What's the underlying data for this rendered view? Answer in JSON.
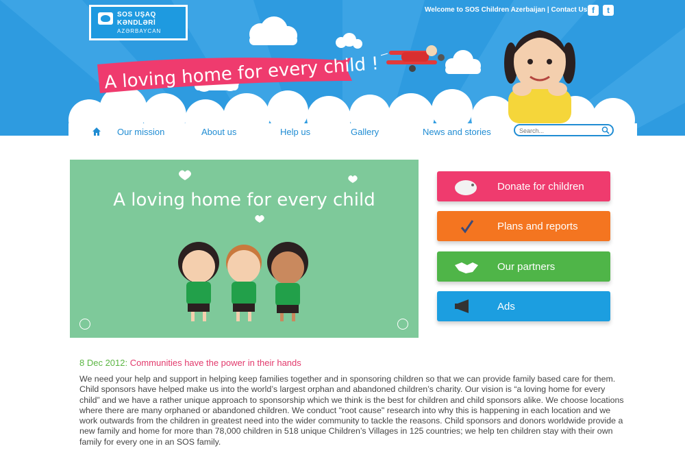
{
  "header": {
    "logo": {
      "line1": "SOS UŞAQ",
      "line2": "KƏNDLƏRİ",
      "line3": "AZƏRBAYCAN"
    },
    "welcome": "Welcome to SOS Children Azerbaijan",
    "separator": " | ",
    "contact": "Contact Us",
    "banner_text": "A loving home for every child !",
    "social": {
      "facebook": "f",
      "twitter": "t"
    }
  },
  "nav": {
    "items": [
      {
        "label": "Our mission"
      },
      {
        "label": "About us"
      },
      {
        "label": "Help us"
      },
      {
        "label": "Gallery"
      },
      {
        "label": "News and stories"
      }
    ]
  },
  "search": {
    "placeholder": "Search..."
  },
  "slider": {
    "text": "A loving home for every child"
  },
  "actions": [
    {
      "label": "Donate for children",
      "icon": "piggy-bank-icon",
      "color": "#ef3b6e"
    },
    {
      "label": "Plans and reports",
      "icon": "checkmark-icon",
      "color": "#f47520"
    },
    {
      "label": "Our partners",
      "icon": "handshake-icon",
      "color": "#4fb548"
    },
    {
      "label": "Ads",
      "icon": "megaphone-icon",
      "color": "#1c9ee0"
    }
  ],
  "news": {
    "date": "8 Dec 2012:",
    "title": "Communities have the power in their hands",
    "body": "We need your help and support in helping keep families  together and in sponsoring children so that we can provide family based care for them. Child sponsors have helped make us into the world’s largest orphan and abandoned children’s charity. Our vision is “a loving home for every child” and we have a rather unique approach to sponsorship which we think is  the best for children and child sponsors alike.  We choose locations where there are many orphaned or abandoned children.  We conduct \"root cause\" research into why this is happening in each location and we  work outwards from the children  in greatest need into the wider community to tackle the reasons. Child sponsors and donors  worldwide provide a new family  and home for more than 78,000 children in 518 unique Children’s Villages in 125 countries; we help ten children stay with their own family for every one in an SOS family."
  },
  "colors": {
    "header_blue": "#2e9be0",
    "nav_blue": "#1f8cd3",
    "slider_green": "#7ec99a",
    "news_date": "#5bb643",
    "news_title": "#e23a6c"
  }
}
